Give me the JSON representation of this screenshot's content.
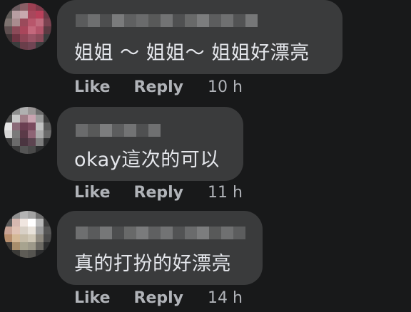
{
  "comments": [
    {
      "text": "姐姐 ～ 姐姐～ 姐姐好漂亮",
      "like_label": "Like",
      "reply_label": "Reply",
      "time": "10 h"
    },
    {
      "text": "okay這次的可以",
      "like_label": "Like",
      "reply_label": "Reply",
      "time": "11 h"
    },
    {
      "text": "真的打扮的好漂亮",
      "like_label": "Like",
      "reply_label": "Reply",
      "time": "14 h"
    }
  ],
  "colors": {
    "background": "#18191a",
    "bubble": "#3a3b3c",
    "text": "#e4e6eb",
    "meta": "#b0b3b8"
  }
}
